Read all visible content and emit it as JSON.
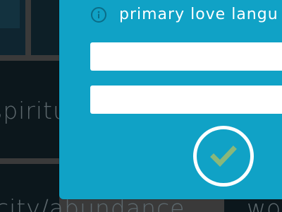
{
  "background": {
    "words": [
      "spiritual",
      "city/abundance",
      "wo"
    ]
  },
  "modal": {
    "prompt_label": "primary love langu",
    "info_icon": "info-icon",
    "fields": [
      {
        "value": "",
        "placeholder": ""
      },
      {
        "value": "",
        "placeholder": ""
      }
    ],
    "submit_icon": "checkmark-icon"
  },
  "colors": {
    "modal_background": "#10a2c6",
    "checkmark": "#8ab77a",
    "icon_outline": "#0a6d88",
    "background_text": "#5d686d"
  }
}
